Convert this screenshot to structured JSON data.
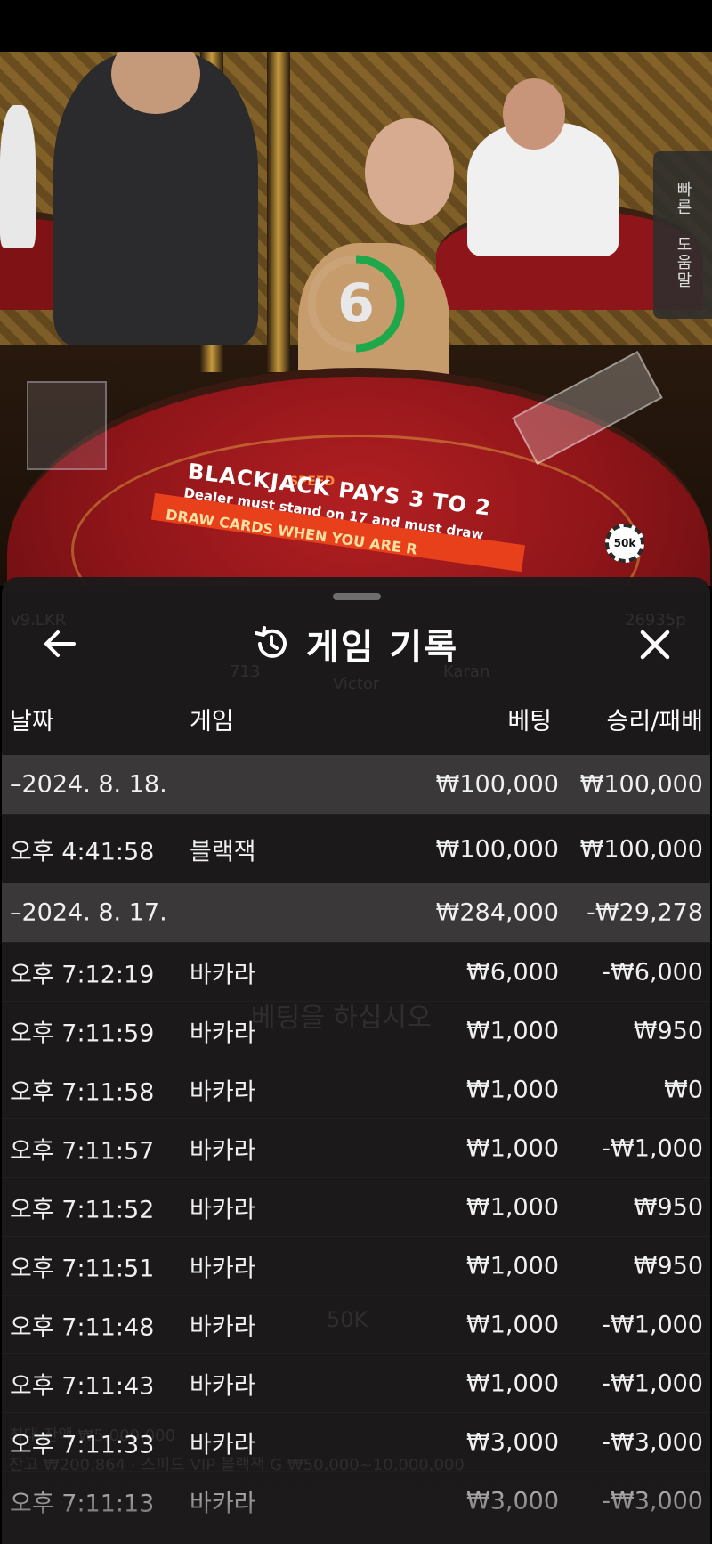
{
  "video": {
    "felt_brand": "SPEED",
    "felt_title": "BLACKJACK PAYS 3 TO 2",
    "felt_subtitle": "Dealer must stand on 17 and must draw",
    "felt_band": "DRAW CARDS WHEN YOU ARE R",
    "chip_label": "50k",
    "countdown": "6",
    "countdown_fraction": 0.5,
    "help_tab": [
      "빠른",
      "도움말"
    ]
  },
  "background_ghost": {
    "seat_left": "v9.LKR",
    "seat_right": "26935p",
    "seat_a": "713",
    "seat_b": "Victor",
    "seat_c": "Karan",
    "place_bets": "베팅을 하십시오",
    "chip": "50K",
    "balance_line_1": "최대 잔액 ₩5,000,000",
    "balance_line_2": "잔고 ₩200,864 · 스피드 VIP 블랙잭 G ₩50,000~10,000,000"
  },
  "sheet": {
    "title": "게임 기록",
    "columns": {
      "date": "날짜",
      "game": "게임",
      "bet": "베팅",
      "result": "승리/패배"
    },
    "rows": [
      {
        "kind": "group",
        "time": "–2024. 8. 18.",
        "game": "",
        "bet": "₩100,000",
        "result": "₩100,000"
      },
      {
        "kind": "entry",
        "time": "오후 4:41:58",
        "game": "블랙잭",
        "bet": "₩100,000",
        "result": "₩100,000"
      },
      {
        "kind": "group",
        "time": "–2024. 8. 17.",
        "game": "",
        "bet": "₩284,000",
        "result": "-₩29,278"
      },
      {
        "kind": "entry",
        "time": "오후 7:12:19",
        "game": "바카라",
        "bet": "₩6,000",
        "result": "-₩6,000"
      },
      {
        "kind": "entry",
        "time": "오후 7:11:59",
        "game": "바카라",
        "bet": "₩1,000",
        "result": "₩950"
      },
      {
        "kind": "entry",
        "time": "오후 7:11:58",
        "game": "바카라",
        "bet": "₩1,000",
        "result": "₩0"
      },
      {
        "kind": "entry",
        "time": "오후 7:11:57",
        "game": "바카라",
        "bet": "₩1,000",
        "result": "-₩1,000"
      },
      {
        "kind": "entry",
        "time": "오후 7:11:52",
        "game": "바카라",
        "bet": "₩1,000",
        "result": "₩950"
      },
      {
        "kind": "entry",
        "time": "오후 7:11:51",
        "game": "바카라",
        "bet": "₩1,000",
        "result": "₩950"
      },
      {
        "kind": "entry",
        "time": "오후 7:11:48",
        "game": "바카라",
        "bet": "₩1,000",
        "result": "-₩1,000"
      },
      {
        "kind": "entry",
        "time": "오후 7:11:43",
        "game": "바카라",
        "bet": "₩1,000",
        "result": "-₩1,000"
      },
      {
        "kind": "entry",
        "time": "오후 7:11:33",
        "game": "바카라",
        "bet": "₩3,000",
        "result": "-₩3,000"
      },
      {
        "kind": "entry",
        "time": "오후 7:11:13",
        "game": "바카라",
        "bet": "₩3,000",
        "result": "-₩3,000"
      }
    ]
  }
}
